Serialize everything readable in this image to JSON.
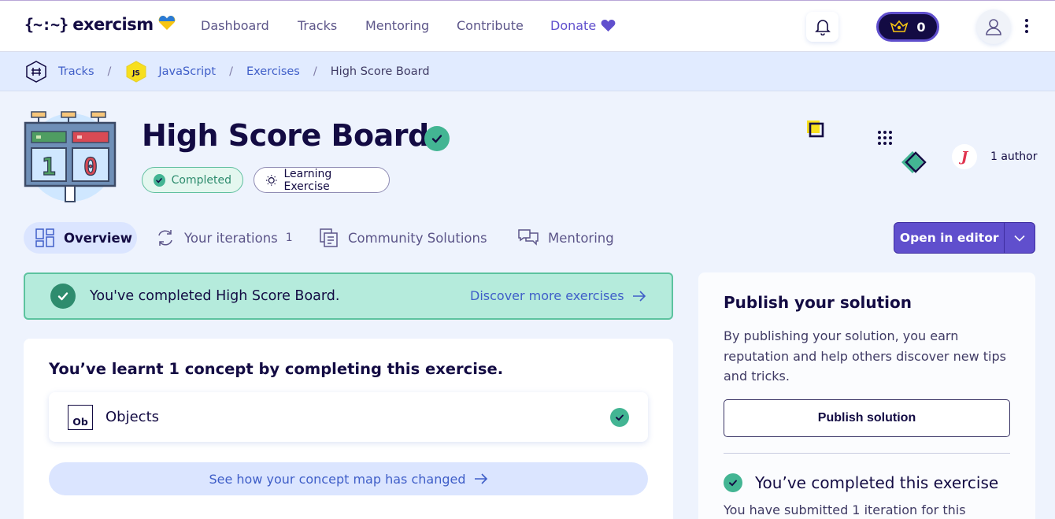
{
  "nav": {
    "logo_braces": "{~:~}",
    "logo_text": "exercism",
    "links": [
      "Dashboard",
      "Tracks",
      "Mentoring",
      "Contribute"
    ],
    "donate": "Donate",
    "reputation": "0"
  },
  "breadcrumb": {
    "tracks": "Tracks",
    "language": "JavaScript",
    "language_badge": "JS",
    "exercises": "Exercises",
    "current": "High Score Board",
    "separator": "/"
  },
  "exercise": {
    "title": "High Score Board",
    "status": "Completed",
    "type": "Learning Exercise",
    "author_initial": "J",
    "authors": "1 author",
    "scoreboard_digits": [
      "1",
      "0"
    ]
  },
  "tabs": {
    "overview": "Overview",
    "iterations": "Your iterations",
    "iterations_count": "1",
    "community": "Community Solutions",
    "mentoring": "Mentoring"
  },
  "editor": {
    "label": "Open in editor"
  },
  "banner": {
    "text": "You've completed High Score Board.",
    "link": "Discover more exercises"
  },
  "concepts": {
    "title": "You’ve learnt 1 concept by completing this exercise.",
    "items": [
      {
        "icon": "Ob",
        "name": "Objects"
      }
    ],
    "map_link": "See how your concept map has changed"
  },
  "sidebar": {
    "title": "Publish your solution",
    "text": "By publishing your solution, you earn reputation and help others discover new tips and tricks.",
    "publish_button": "Publish solution",
    "completed_title": "You’ve completed this exercise",
    "completed_sub": "You have submitted 1 iteration for this"
  },
  "colors": {
    "accent": "#604fcd",
    "success": "#43b593",
    "link": "#3f5ec8",
    "navy": "#130b43"
  }
}
